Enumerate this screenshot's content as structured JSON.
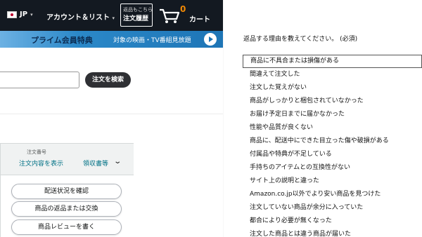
{
  "nav": {
    "locale": "JP",
    "account": "アカウント＆リスト",
    "orders_line1": "返品もこちら",
    "orders_line2": "注文履歴",
    "cart_count": "0",
    "cart_label": "カート"
  },
  "prime": {
    "title": "プライム会員特典",
    "video_text": "対象の映画・TV番組見放題"
  },
  "search": {
    "button": "注文を検索",
    "value": ""
  },
  "order": {
    "number_label": "注文番号",
    "details_link": "注文内容を表示",
    "receipt_link": "領収書等",
    "actions": [
      "配送状況を確認",
      "商品の返品または交換",
      "商品レビューを書く"
    ]
  },
  "return_reason": {
    "title": "返品する理由を教えてください。 (必須)",
    "options": [
      "商品に不具合または損傷がある",
      "間違えて注文した",
      "注文した覚えがない",
      "商品がしっかりと梱包されていなかった",
      "お届け予定日までに届かなかった",
      "性能や品質が良くない",
      "商品に、配送中にできた目立った傷や破損がある",
      "付属品や特典が不足している",
      "手持ちのアイテムとの互換性がない",
      "サイト上の説明と違った",
      "Amazon.co.jp以外でより安い商品を見つけた",
      "注文していない商品が余分に入っていた",
      "都合により必要が無くなった",
      "注文した商品とは違う商品が届いた"
    ]
  }
}
